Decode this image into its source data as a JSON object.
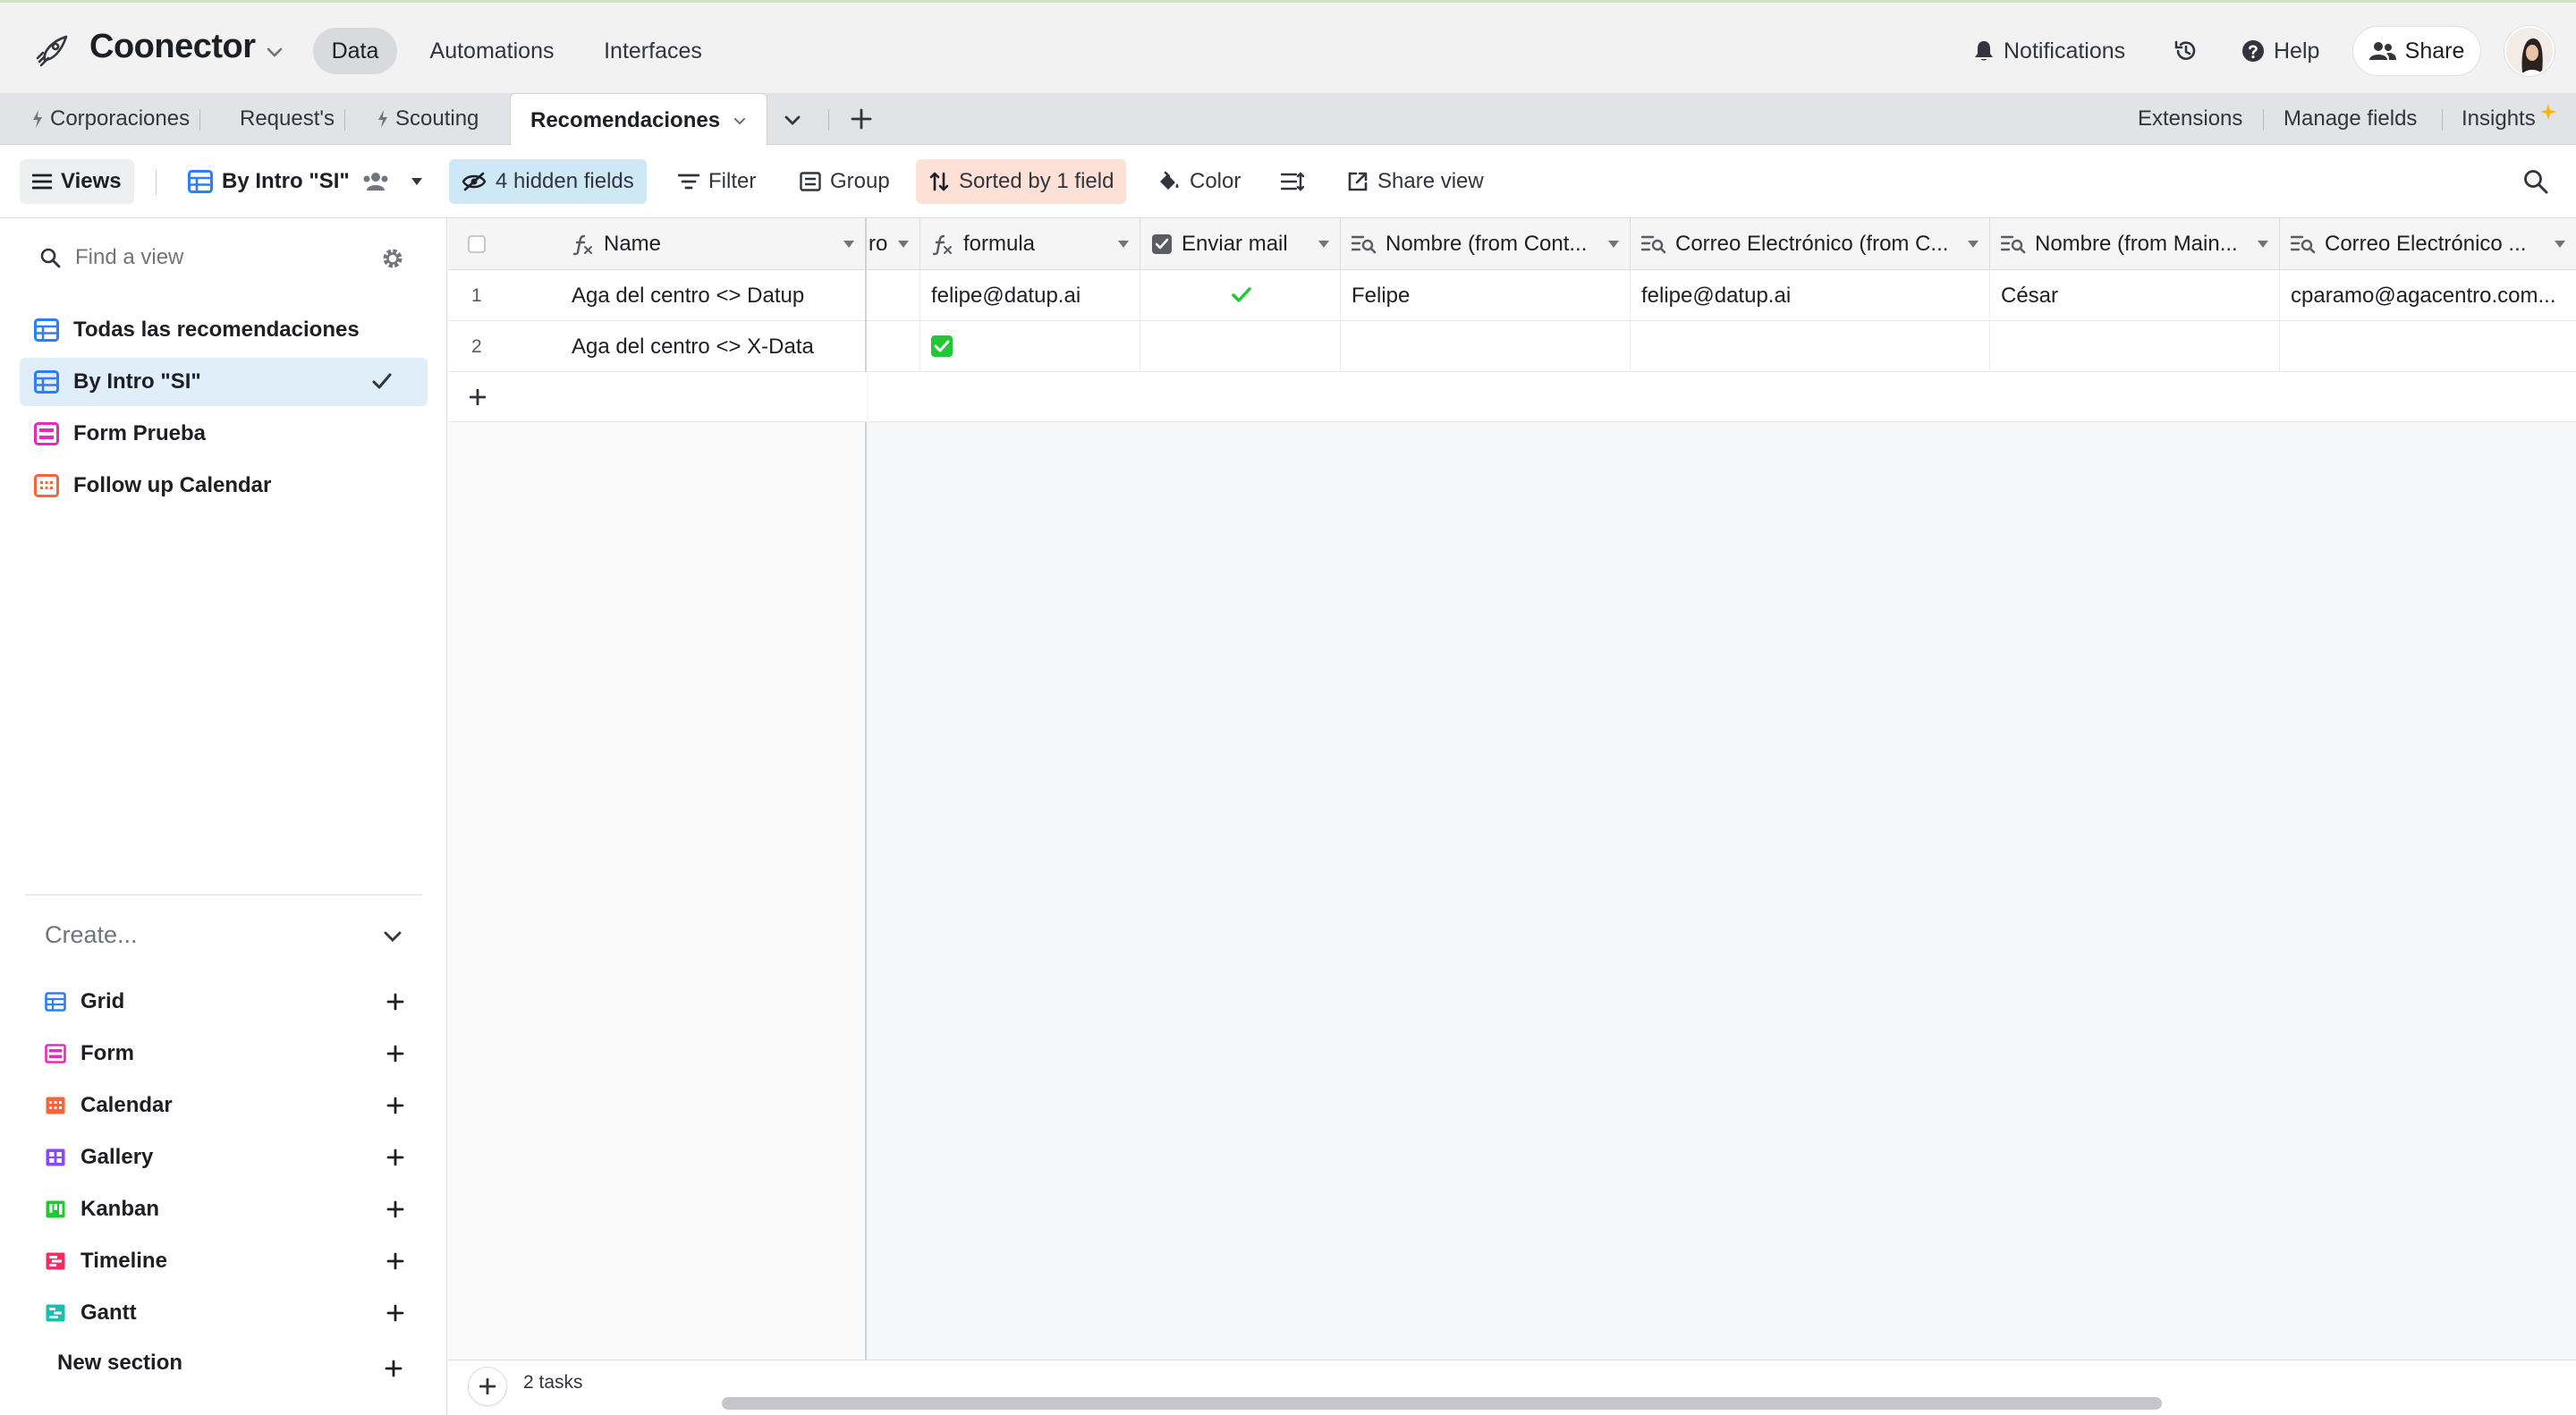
{
  "topbar": {
    "base_name": "Coonector",
    "tabs": [
      {
        "label": "Data",
        "active": true
      },
      {
        "label": "Automations",
        "active": false
      },
      {
        "label": "Interfaces",
        "active": false
      }
    ],
    "notifications_label": "Notifications",
    "help_label": "Help",
    "share_label": "Share"
  },
  "table_tabs": {
    "tabs": [
      {
        "label": "Corporaciones",
        "icon": "bolt-icon"
      },
      {
        "label": "Request's"
      },
      {
        "label": "Scouting",
        "icon": "bolt-icon"
      },
      {
        "label": "Recomendaciones",
        "active": true
      }
    ],
    "extensions_label": "Extensions",
    "manage_fields_label": "Manage fields",
    "insights_label": "Insights"
  },
  "toolbar": {
    "views_label": "Views",
    "current_view": "By Intro \"SI\"",
    "hidden_fields": "4 hidden fields",
    "filter_label": "Filter",
    "group_label": "Group",
    "sorted_label": "Sorted by 1 field",
    "color_label": "Color",
    "share_view_label": "Share view"
  },
  "sidebar": {
    "find_placeholder": "Find a view",
    "views": [
      {
        "label": "Todas las recomendaciones",
        "type": "grid"
      },
      {
        "label": "By Intro \"SI\"",
        "type": "grid",
        "selected": true
      },
      {
        "label": "Form Prueba",
        "type": "form"
      },
      {
        "label": "Follow up Calendar",
        "type": "calendar"
      }
    ],
    "create_label": "Create...",
    "create_items": [
      {
        "label": "Grid",
        "color": "#2d7ff9"
      },
      {
        "label": "Form",
        "color": "#e929ba"
      },
      {
        "label": "Calendar",
        "color": "#f7653b"
      },
      {
        "label": "Gallery",
        "color": "#8b46ff"
      },
      {
        "label": "Kanban",
        "color": "#20c933"
      },
      {
        "label": "Timeline",
        "color": "#f82b60"
      },
      {
        "label": "Gantt",
        "color": "#18bfb0"
      }
    ],
    "new_section_label": "New section"
  },
  "grid": {
    "columns": {
      "name": "Name",
      "partial": "ro",
      "formula": "formula",
      "enviar_mail": "Enviar mail",
      "nombre_cont": "Nombre (from Cont...",
      "correo_c": "Correo Electrónico (from C...",
      "nombre_main": "Nombre (from Main...",
      "correo_last": "Correo Electrónico ..."
    },
    "rows": [
      {
        "num": "1",
        "name": "Aga del centro <> Datup",
        "formula": "felipe@datup.ai",
        "enviar_mail": true,
        "nombre_cont": "Felipe",
        "correo_c": "felipe@datup.ai",
        "nombre_main": "César",
        "correo_last": "cparamo@agacentro.com..."
      },
      {
        "num": "2",
        "name": "Aga del centro <> X-Data",
        "formula_checkbox": true,
        "nombre_cont": "",
        "correo_c": "",
        "nombre_main": "",
        "correo_last": ""
      }
    ],
    "record_count": "2 tasks"
  },
  "colors": {
    "accent_blue": "#2d7ff9",
    "hidden_fields_bg": "#cfe8f5",
    "sorted_bg": "#fde0d6",
    "check_green": "#20c933"
  }
}
